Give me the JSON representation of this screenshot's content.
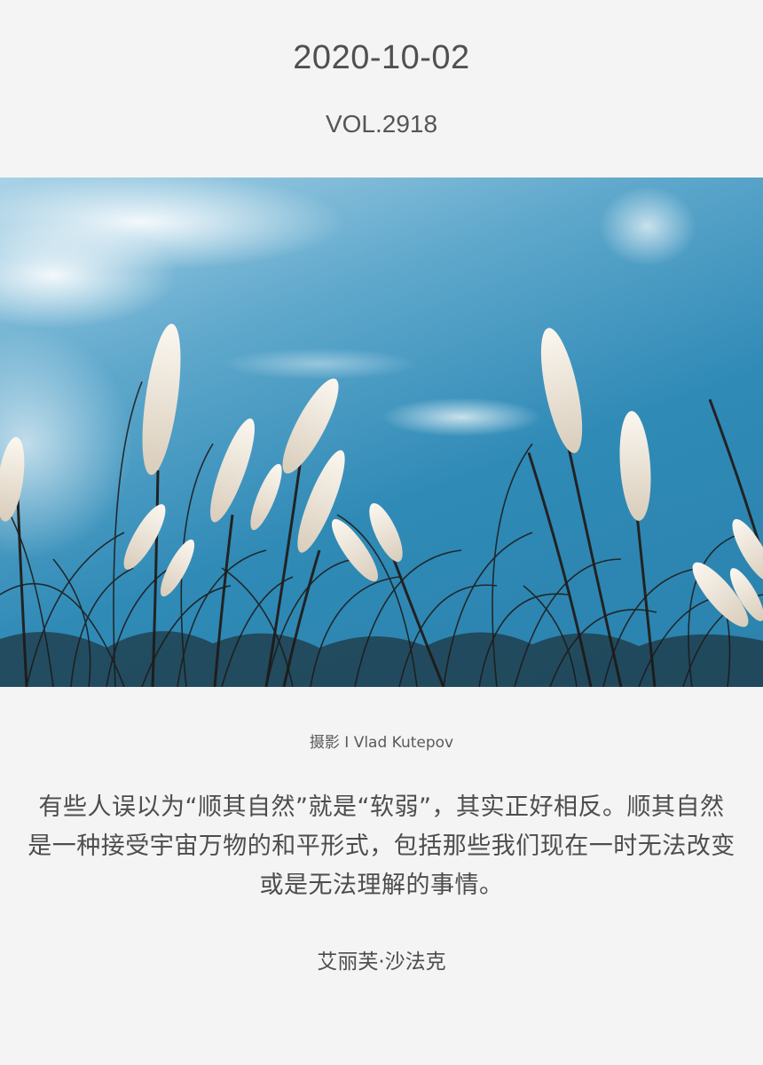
{
  "header": {
    "date": "2020-10-02",
    "volume": "VOL.2918"
  },
  "photo": {
    "subject": "pampas-grass-blue-sky",
    "colors": {
      "sky_top": "#a9d2e6",
      "sky": "#2f8ab6",
      "grass_plume": "#f3ece2",
      "grass_stem": "#2a2a2a"
    }
  },
  "credit": {
    "text": "摄影 I Vlad Kutepov"
  },
  "quote": {
    "text": "有些人误以为“顺其自然”就是“软弱”，其实正好相反。顺其自然是一种接受宇宙万物的和平形式，包括那些我们现在一时无法改变或是无法理解的事情。"
  },
  "author": {
    "name": "艾丽芙·沙法克"
  }
}
